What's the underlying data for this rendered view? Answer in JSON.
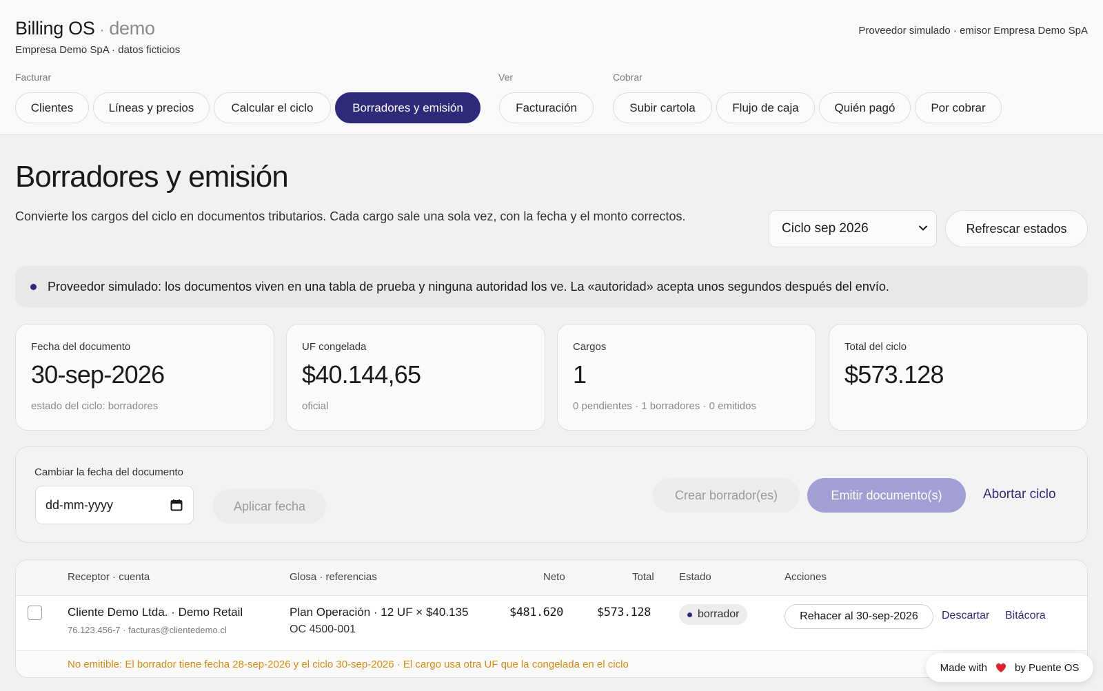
{
  "header": {
    "brand": "Billing OS",
    "brand_sep": "·",
    "brand_demo": "demo",
    "subtitle": "Empresa Demo SpA · datos ficticios",
    "provider_note": "Proveedor simulado · emisor Empresa Demo SpA"
  },
  "nav": {
    "groups": [
      {
        "label": "Facturar"
      },
      {
        "label": "Ver"
      },
      {
        "label": "Cobrar"
      }
    ],
    "items": [
      {
        "label": "Clientes",
        "active": false
      },
      {
        "label": "Líneas y precios",
        "active": false
      },
      {
        "label": "Calcular el ciclo",
        "active": false
      },
      {
        "label": "Borradores y emisión",
        "active": true
      },
      {
        "label": "Facturación",
        "active": false
      },
      {
        "label": "Subir cartola",
        "active": false
      },
      {
        "label": "Flujo de caja",
        "active": false
      },
      {
        "label": "Quién pagó",
        "active": false
      },
      {
        "label": "Por cobrar",
        "active": false
      }
    ]
  },
  "page": {
    "title": "Borradores y emisión",
    "description": "Convierte los cargos del ciclo en documentos tributarios. Cada cargo sale una sola vez, con la fecha y el monto correctos.",
    "cycle_select": "Ciclo sep 2026",
    "refresh_label": "Refrescar estados",
    "notice": "Proveedor simulado: los documentos viven en una tabla de prueba y ninguna autoridad los ve. La «autoridad» acepta unos segundos después del envío."
  },
  "stats": [
    {
      "label": "Fecha del documento",
      "value": "30-sep-2026",
      "sub": "estado del ciclo: borradores"
    },
    {
      "label": "UF congelada",
      "value": "$40.144,65",
      "sub": "oficial"
    },
    {
      "label": "Cargos",
      "value": "1",
      "sub": "0 pendientes · 1 borradores · 0 emitidos"
    },
    {
      "label": "Total del ciclo",
      "value": "$573.128",
      "sub": ""
    }
  ],
  "date_panel": {
    "label": "Cambiar la fecha del documento",
    "date_placeholder": "dd-mm-yyyy",
    "apply_label": "Aplicar fecha",
    "create_label": "Crear borrador(es)",
    "emit_label": "Emitir documento(s)",
    "abort_label": "Abortar ciclo"
  },
  "table": {
    "headers": [
      "Receptor · cuenta",
      "Glosa · referencias",
      "Neto",
      "Total",
      "Estado",
      "Acciones"
    ],
    "rows": [
      {
        "receptor": "Cliente Demo Ltda. · Demo Retail",
        "receptor_sub": "76.123.456-7 · facturas@clientedemo.cl",
        "glosa": "Plan Operación · 12 UF × $40.135",
        "glosa_ref": "OC 4500-001",
        "neto": "$481.620",
        "total": "$573.128",
        "estado": "borrador",
        "redo_label": "Rehacer al 30-sep-2026",
        "discard_label": "Descartar",
        "log_label": "Bitácora"
      }
    ],
    "warning": "No emitible: El borrador tiene fecha 28-sep-2026 y el ciclo 30-sep-2026 · El cargo usa otra UF que la congelada en el ciclo"
  },
  "footer_badge": {
    "made_with": "Made with",
    "by": "by Puente OS"
  },
  "colors": {
    "accent": "#2e2a7a",
    "emit_disabled": "#a29fd4",
    "warning": "#d98a0c"
  }
}
